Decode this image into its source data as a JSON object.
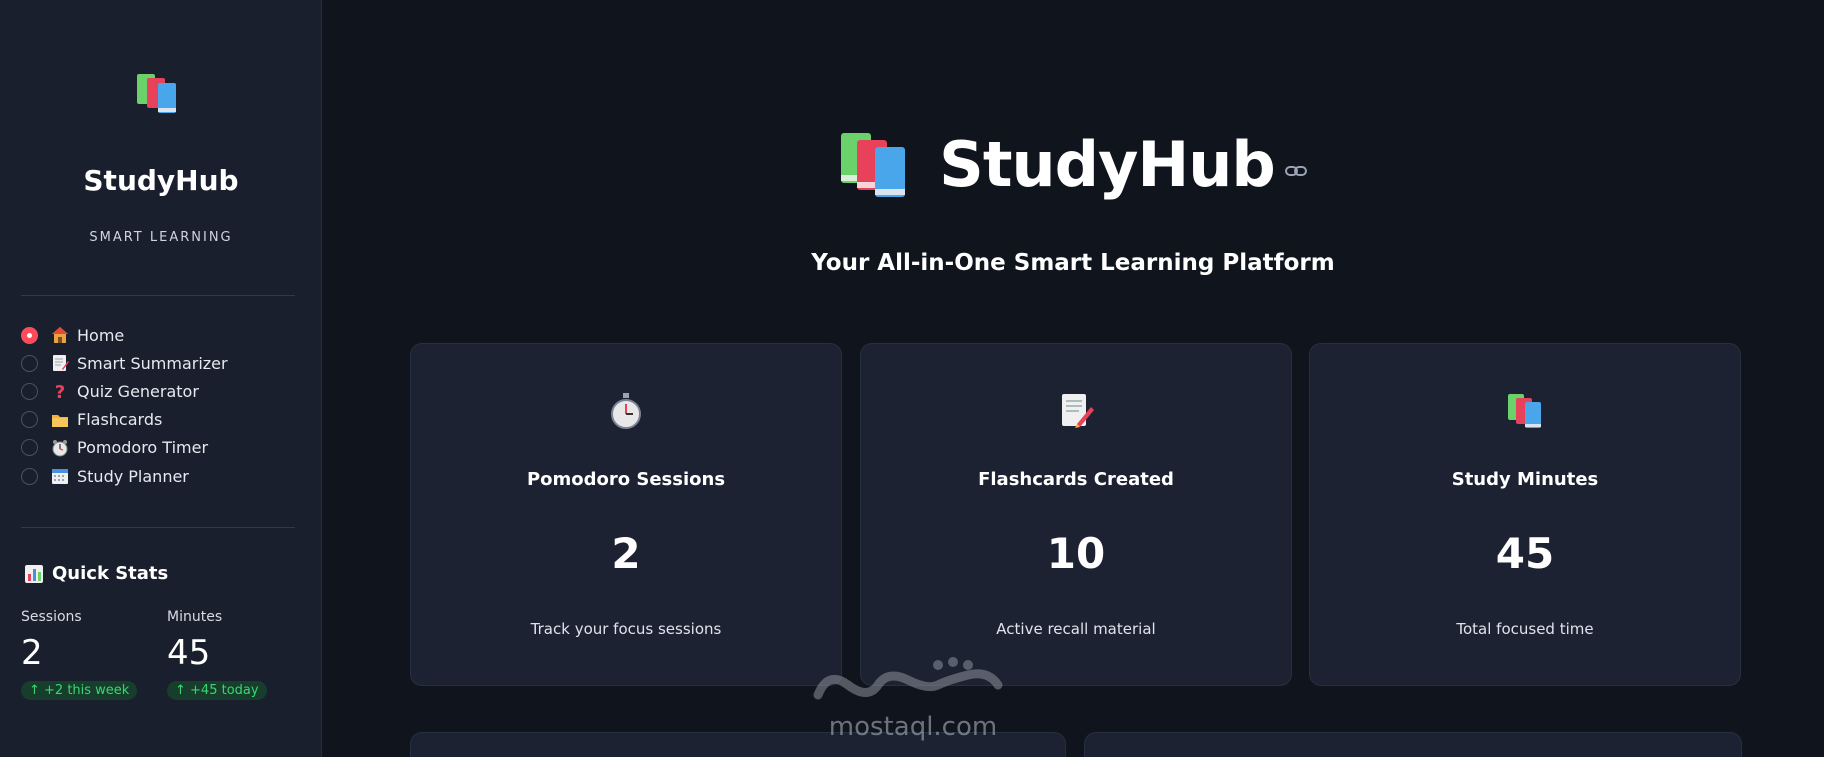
{
  "sidebar": {
    "brand_name": "StudyHub",
    "brand_tagline": "SMART LEARNING",
    "nav": [
      {
        "icon": "house-icon",
        "label": "Home",
        "selected": true
      },
      {
        "icon": "memo-icon",
        "label": "Smart Summarizer",
        "selected": false
      },
      {
        "icon": "question-mark-icon",
        "label": "Quiz Generator",
        "selected": false
      },
      {
        "icon": "folder-icon",
        "label": "Flashcards",
        "selected": false
      },
      {
        "icon": "alarm-clock-icon",
        "label": "Pomodoro Timer",
        "selected": false
      },
      {
        "icon": "calendar-icon",
        "label": "Study Planner",
        "selected": false
      }
    ],
    "quick_stats": {
      "title": "Quick Stats",
      "sessions_label": "Sessions",
      "sessions_value": "2",
      "sessions_delta": "↑ +2 this week",
      "minutes_label": "Minutes",
      "minutes_value": "45",
      "minutes_delta": "↑ +45 today"
    }
  },
  "hero": {
    "title": "StudyHub",
    "subtitle": "Your All-in-One Smart Learning Platform"
  },
  "cards": [
    {
      "icon": "stopwatch-icon",
      "title": "Pomodoro Sessions",
      "value": "2",
      "desc": "Track your focus sessions"
    },
    {
      "icon": "memo-icon",
      "title": "Flashcards Created",
      "value": "10",
      "desc": "Active recall material"
    },
    {
      "icon": "books-icon",
      "title": "Study Minutes",
      "value": "45",
      "desc": "Total focused time"
    }
  ],
  "watermark": {
    "text": "mostaql.com"
  },
  "colors": {
    "accent": "#ff4b5c",
    "background": "#0f141d",
    "sidebar": "#1a1f2d",
    "card": "#1c2232",
    "delta_text": "#3bd671",
    "delta_bg": "#173d2c"
  }
}
